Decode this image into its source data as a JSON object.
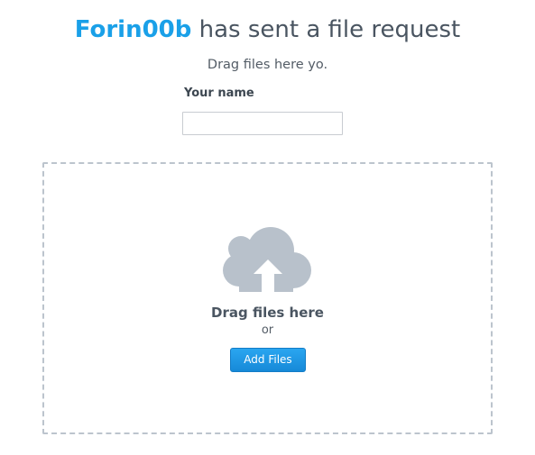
{
  "header": {
    "sender": "Forin00b",
    "title_suffix": " has sent a file request"
  },
  "request": {
    "message": "Drag files here yo."
  },
  "form": {
    "name_label": "Your name",
    "name_value": ""
  },
  "dropzone": {
    "icon": "cloud-upload-icon",
    "title": "Drag files here",
    "or_text": "or",
    "add_button_label": "Add Files"
  },
  "colors": {
    "accent": "#1aa0e8",
    "text": "#4a5561",
    "icon": "#b8c1cb",
    "border": "#bcc4cd"
  }
}
